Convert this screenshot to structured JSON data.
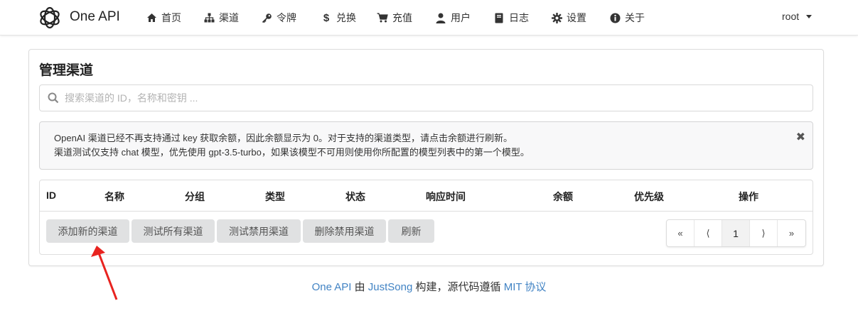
{
  "nav": {
    "brand": "One API",
    "items": [
      {
        "label": "首页",
        "icon": "home-icon"
      },
      {
        "label": "渠道",
        "icon": "sitemap-icon"
      },
      {
        "label": "令牌",
        "icon": "key-icon"
      },
      {
        "label": "兑换",
        "icon": "dollar-icon"
      },
      {
        "label": "充值",
        "icon": "cart-icon"
      },
      {
        "label": "用户",
        "icon": "user-icon"
      },
      {
        "label": "日志",
        "icon": "book-icon"
      },
      {
        "label": "设置",
        "icon": "gear-icon"
      },
      {
        "label": "关于",
        "icon": "info-icon"
      }
    ],
    "user": "root"
  },
  "page": {
    "title": "管理渠道",
    "search_placeholder": "搜索渠道的 ID，名称和密钥 ..."
  },
  "message": {
    "line1": "OpenAI 渠道已经不再支持通过 key 获取余额，因此余额显示为 0。对于支持的渠道类型，请点击余额进行刷新。",
    "line2": "渠道测试仅支持 chat 模型，优先使用 gpt-3.5-turbo，如果该模型不可用则使用你所配置的模型列表中的第一个模型。",
    "close": "✖"
  },
  "table": {
    "columns": [
      "ID",
      "名称",
      "分组",
      "类型",
      "状态",
      "响应时间",
      "余额",
      "优先级",
      "操作"
    ]
  },
  "actions": [
    "添加新的渠道",
    "测试所有渠道",
    "测试禁用渠道",
    "删除禁用渠道",
    "刷新"
  ],
  "pagination": {
    "first": "«",
    "prev": "⟨",
    "current": "1",
    "next": "⟩",
    "last": "»"
  },
  "footer": {
    "app": "One API",
    "by": "由",
    "author": "JustSong",
    "mid": "构建，源代码遵循",
    "license": "MIT 协议"
  },
  "colors": {
    "link": "#4183c4",
    "arrow": "#e8231f",
    "button": "#e0e1e2"
  }
}
